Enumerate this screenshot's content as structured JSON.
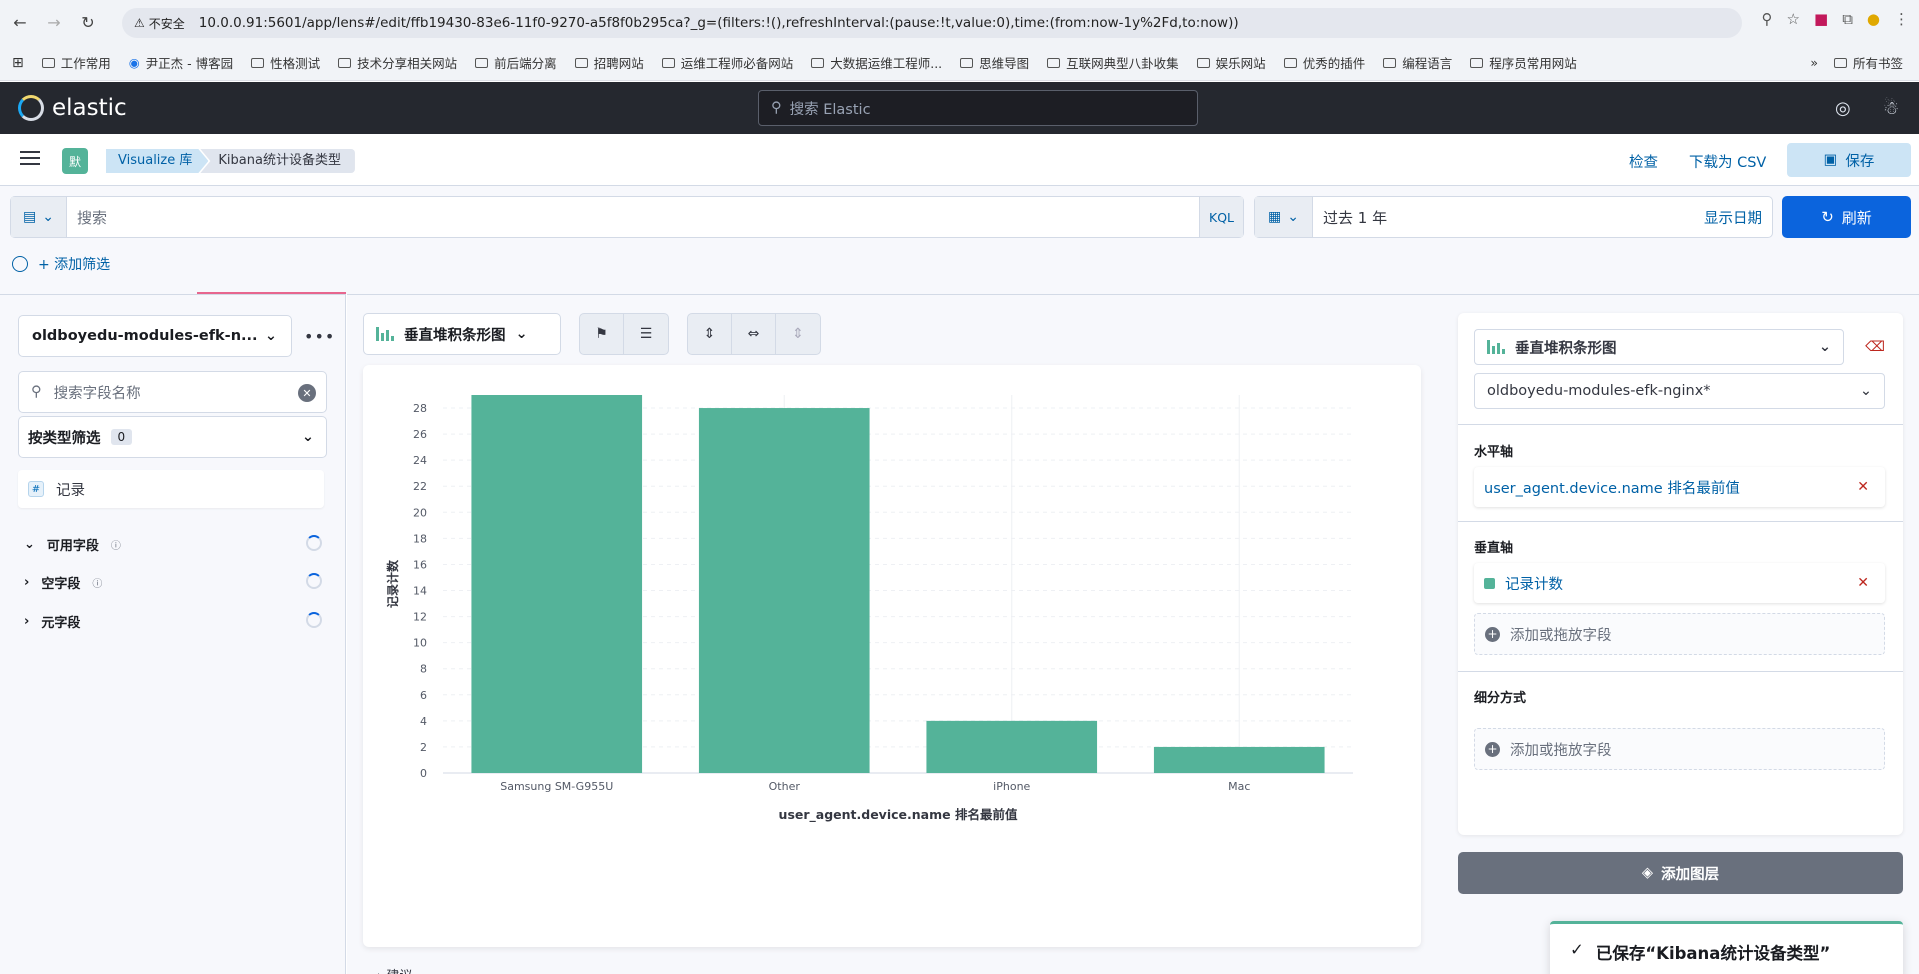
{
  "browser": {
    "insecure_label": "不安全",
    "url": "10.0.0.91:5601/app/lens#/edit/ffb19430-83e6-11f0-9270-a5f8f0b295ca?_g=(filters:!(),refreshInterval:(pause:!t,value:0),time:(from:now-1y%2Fd,to:now))"
  },
  "bookmarks": {
    "items": [
      "工作常用",
      "尹正杰 - 博客园",
      "性格测试",
      "技术分享相关网站",
      "前后端分离",
      "招聘网站",
      "运维工程师必备网站",
      "大数据运维工程师...",
      "思维导图",
      "互联网典型八卦收集",
      "娱乐网站",
      "优秀的插件",
      "编程语言",
      "程序员常用网站"
    ],
    "more": "»",
    "all_bookmarks": "所有书签"
  },
  "elastic": {
    "logo_text": "elastic",
    "search_placeholder": "搜索 Elastic"
  },
  "app_header": {
    "space_badge": "默",
    "breadcrumb_1": "Visualize 库",
    "breadcrumb_2": "Kibana统计设备类型",
    "inspect": "检查",
    "download_csv": "下载为 CSV",
    "save": "保存"
  },
  "query_bar": {
    "search_placeholder": "搜索",
    "kql": "KQL",
    "date_range": "过去 1 年",
    "show_dates": "显示日期",
    "refresh": "刷新",
    "add_filter": "+ 添加筛选"
  },
  "left_panel": {
    "data_view": "oldboyedu-modules-efk-n...",
    "field_search_placeholder": "搜索字段名称",
    "type_filter_label": "按类型筛选",
    "type_filter_count": "0",
    "record_field": "记录",
    "available_fields": "可用字段",
    "empty_fields": "空字段",
    "meta_fields": "元字段"
  },
  "workspace": {
    "chart_type": "垂直堆积条形图",
    "bottom_hint": "建议"
  },
  "chart_data": {
    "type": "bar",
    "categories": [
      "Samsung SM-G955U",
      "Other",
      "iPhone",
      "Mac"
    ],
    "values": [
      29,
      28,
      4,
      2
    ],
    "xlabel": "user_agent.device.name 排名最前值",
    "ylabel": "记录计数",
    "ylim": [
      0,
      29
    ],
    "yticks": [
      0,
      2,
      4,
      6,
      8,
      10,
      12,
      14,
      16,
      18,
      20,
      22,
      24,
      26,
      28
    ],
    "bar_color": "#54b399",
    "grid": true
  },
  "right_panel": {
    "layer_type": "垂直堆积条形图",
    "data_view": "oldboyedu-modules-efk-nginx*",
    "x_axis_title": "水平轴",
    "x_axis_item": "user_agent.device.name 排名最前值",
    "y_axis_title": "垂直轴",
    "y_axis_item": "记录计数",
    "add_field": "添加或拖放字段",
    "breakdown_title": "细分方式",
    "add_layer": "添加图层"
  },
  "toast": {
    "message": "已保存“Kibana统计设备类型”"
  }
}
